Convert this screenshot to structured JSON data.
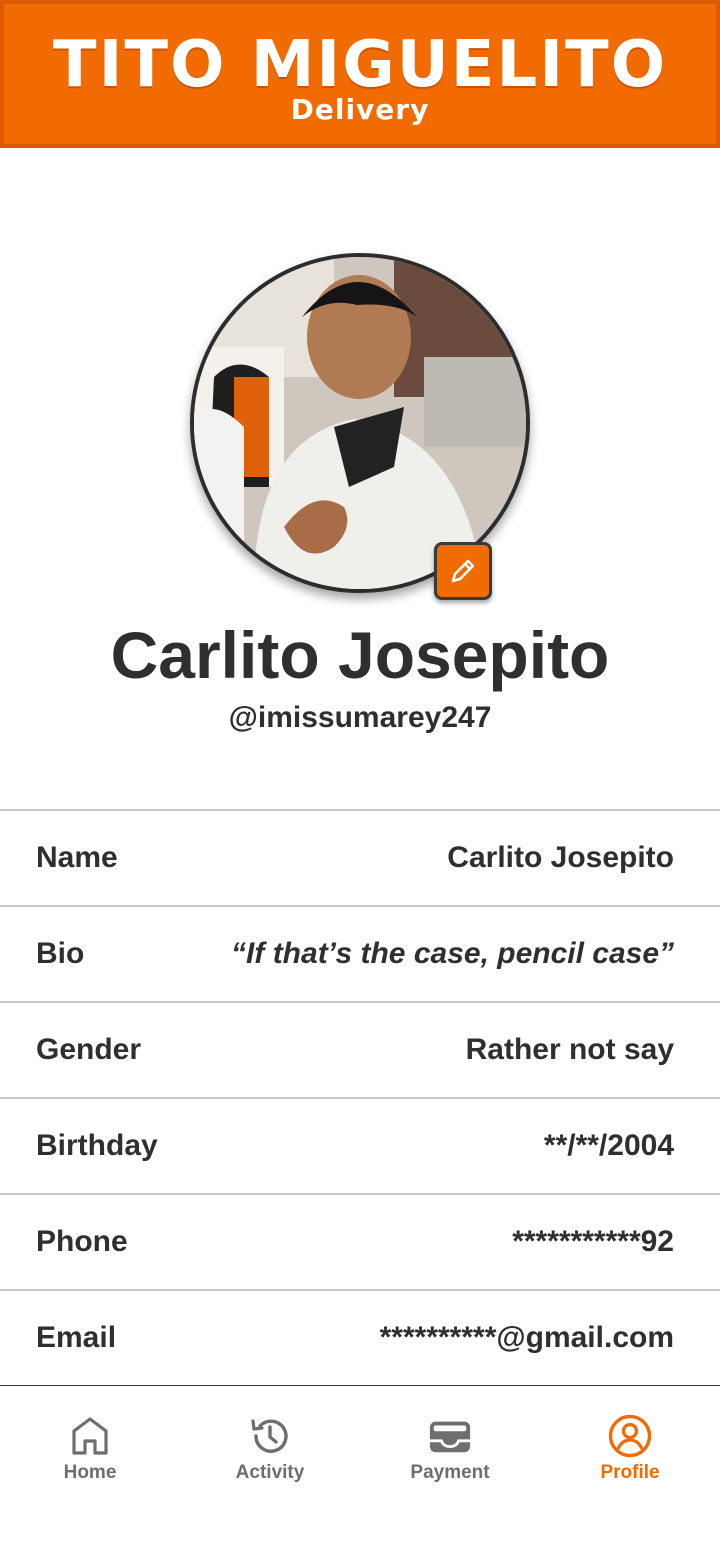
{
  "header": {
    "title": "TITO MIGUELITO",
    "subtitle": "Delivery"
  },
  "profile": {
    "display_name": "Carlito Josepito",
    "handle": "@imissumarey247",
    "avatar_alt": "Profile photo",
    "edit_icon": "pencil-icon"
  },
  "info_rows": [
    {
      "label": "Name",
      "value": "Carlito Josepito"
    },
    {
      "label": "Bio",
      "value": "“If that’s the case, pencil case”"
    },
    {
      "label": "Gender",
      "value": "Rather not say"
    },
    {
      "label": "Birthday",
      "value": "**/**/2004"
    },
    {
      "label": "Phone",
      "value": "***********92"
    },
    {
      "label": "Email",
      "value": "**********@gmail.com"
    }
  ],
  "nav": [
    {
      "label": "Home",
      "icon": "home-icon",
      "active": false
    },
    {
      "label": "Activity",
      "icon": "history-icon",
      "active": false
    },
    {
      "label": "Payment",
      "icon": "wallet-icon",
      "active": false
    },
    {
      "label": "Profile",
      "icon": "user-icon",
      "active": true
    }
  ],
  "colors": {
    "accent": "#f26b00",
    "text": "#2f2f2f",
    "nav_inactive": "#6e6e6e"
  }
}
